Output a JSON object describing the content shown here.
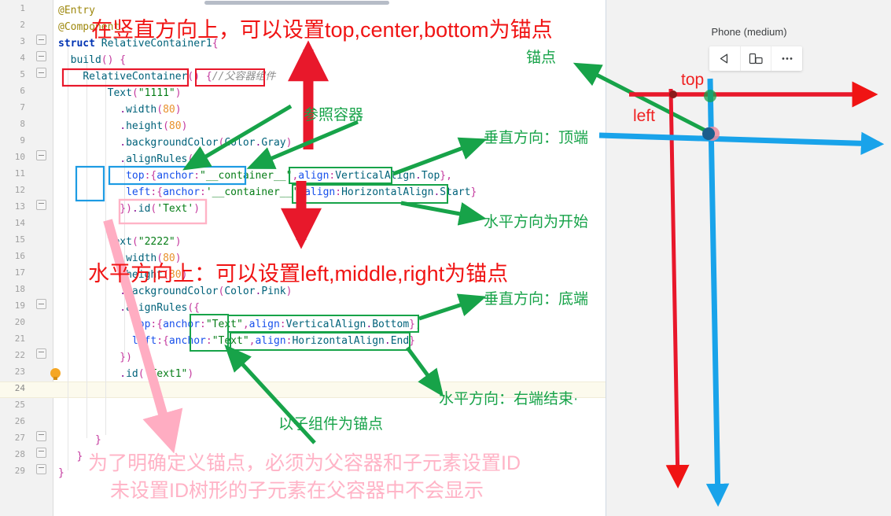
{
  "editor": {
    "line_numbers": [
      "1",
      "2",
      "3",
      "4",
      "5",
      "6",
      "7",
      "8",
      "9",
      "10",
      "11",
      "12",
      "13",
      "14",
      "15",
      "16",
      "17",
      "18",
      "19",
      "20",
      "21",
      "22",
      "23",
      "24",
      "25",
      "26",
      "27",
      "28",
      "29"
    ],
    "code_lines": [
      "@Entry",
      "@Component",
      "struct RelativeContainer1{",
      "  build() {",
      "    RelativeContainer() {//父容器组件",
      "        Text(\"1111\")",
      "          .width(80)",
      "          .height(80)",
      "          .backgroundColor(Color.Gray)",
      "          .alignRules({",
      "            top:{anchor:\"__container__\",align:VerticalAlign.Top},",
      "            left:{anchor:'__container__',align:HorizontalAlign.Start}",
      "          }).id('Text')",
      "",
      "        Text(\"2222\")",
      "          .width(80)",
      "          .height(80)",
      "          .backgroundColor(Color.Pink)",
      "          .alignRules({",
      "            top:{anchor:\"Text\",align:VerticalAlign.Bottom},",
      "            left:{anchor:\"Text\",align:HorizontalAlign.End}",
      "          })",
      "          .id(\"Text1\")",
      "",
      "",
      "",
      "      }",
      "   }",
      "}"
    ],
    "highlighted_line": "24",
    "bulb_line": "23"
  },
  "annotations": {
    "title_vertical": "在竖直方向上，可以设置top,center,bottom为锚点",
    "title_horizontal": "水平方向上：可以设置left,middle,right为锚点",
    "anchor_label": "锚点",
    "reference_container": "参照容器",
    "vertical_top": "垂直方向：顶端",
    "horizontal_start": "水平方向为开始",
    "vertical_bottom": "垂直方向：底端",
    "horizontal_end": "水平方向：右端结束·",
    "child_as_anchor": "以子组件为锚点",
    "footer_line1": "为了明确定义锚点，必须为父容器和子元素设置ID",
    "footer_line2": "未设置ID树形的子元素在父容器中不会显示",
    "phone_top_axis": "top",
    "phone_left_axis": "left"
  },
  "preview": {
    "title": "Phone (medium)",
    "toolbar": {
      "rotate_label": "rotate-left",
      "orientation_label": "orientation",
      "more_label": "…"
    }
  },
  "colors": {
    "red": "#f01414",
    "green": "#17a349",
    "pink": "#ffb3c6",
    "blue": "#2196e8",
    "gray_block": "#808080",
    "pink_block": "#ffc7cf",
    "highlight_row": "#fcfaed"
  }
}
